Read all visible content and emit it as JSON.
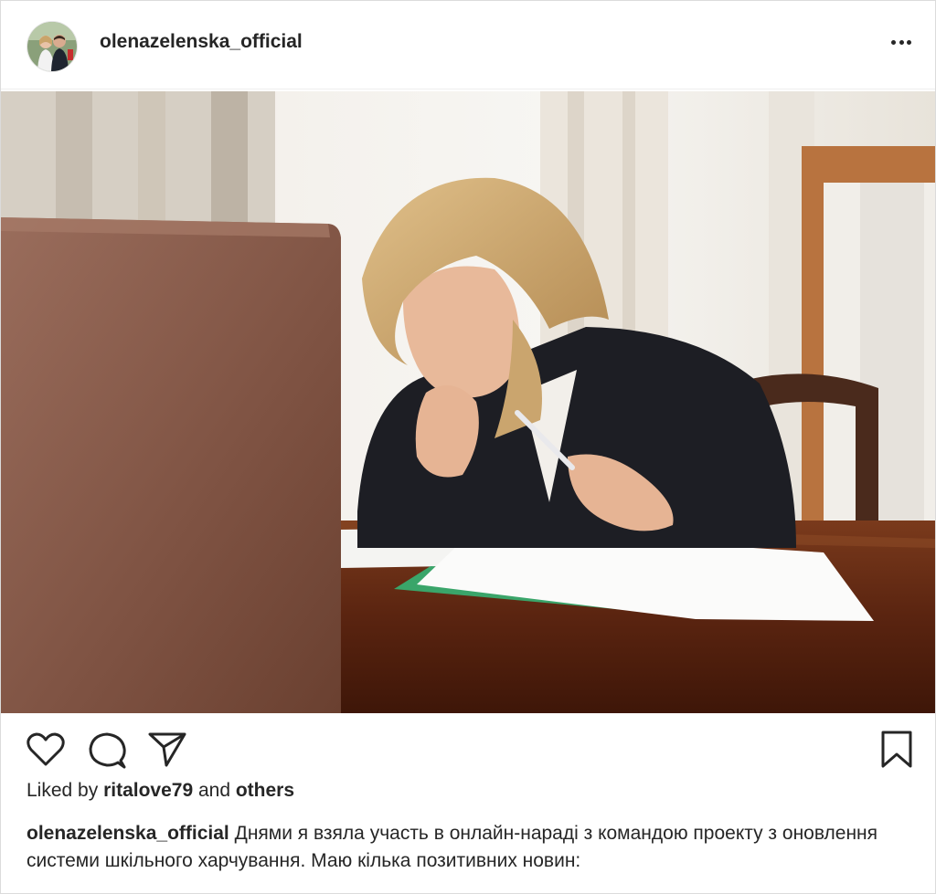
{
  "header": {
    "username": "olenazelenska_official",
    "avatar_icon": "profile-photo-couple",
    "more_icon": "more-horizontal-icon"
  },
  "photo": {
    "content": "woman-at-desk-video-meeting"
  },
  "actions": {
    "like_icon": "heart-icon",
    "comment_icon": "comment-icon",
    "share_icon": "paper-plane-icon",
    "save_icon": "bookmark-icon"
  },
  "likes": {
    "prefix": "Liked by",
    "user": "ritalove79",
    "and": "and",
    "others": "others"
  },
  "caption": {
    "username": "olenazelenska_official",
    "text": "Днями я взяла участь в онлайн-нараді з командою проекту з оновлення системи шкільного харчування. Маю кілька позитивних новин:"
  },
  "colors": {
    "text": "#262626",
    "border": "#dbdbdb",
    "background": "#ffffff"
  }
}
